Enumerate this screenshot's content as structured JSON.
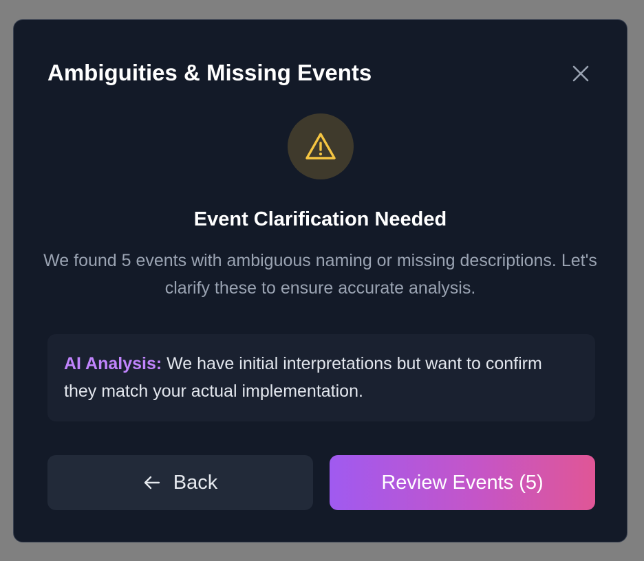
{
  "dialog": {
    "title": "Ambiguities & Missing Events",
    "heading": "Event Clarification Needed",
    "description": "We found 5 events with ambiguous naming or missing descriptions. Let's clarify these to ensure accurate analysis.",
    "info": {
      "label": "AI Analysis:",
      "text": " We have initial interpretations but want to confirm they match your actual implementation."
    },
    "buttons": {
      "back_label": "Back",
      "review_label": "Review Events (5)"
    },
    "icons": {
      "close": "close-icon",
      "warning": "warning-triangle-icon",
      "back": "arrow-left-icon"
    },
    "colors": {
      "background": "#131a28",
      "accent_purple": "#c084fc",
      "warning": "#f5c542",
      "gradient_start": "#a05af0",
      "gradient_end": "#e05696"
    }
  }
}
